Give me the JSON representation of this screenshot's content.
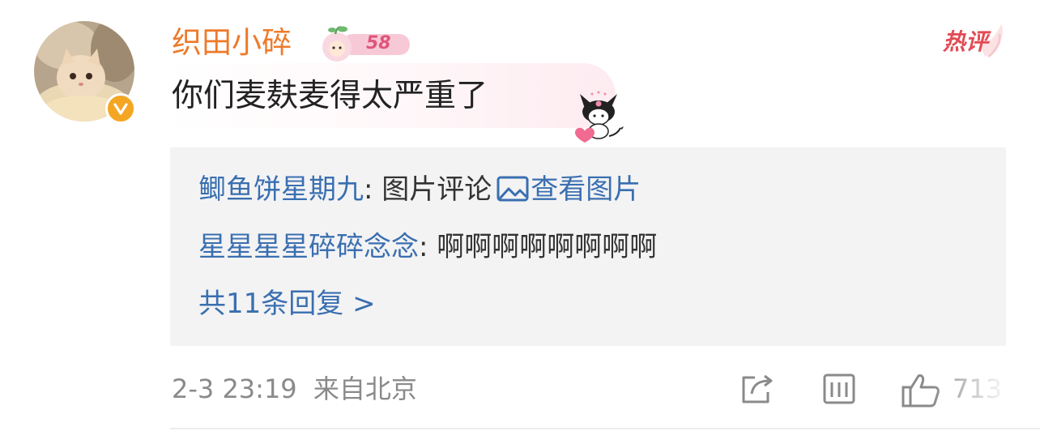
{
  "comment": {
    "username": "织田小碎",
    "level_badge": "58",
    "hot_label": "热评",
    "text": "你们麦麸麦得太严重了",
    "colors": {
      "username": "#ee7a2a",
      "link": "#3a6fb0",
      "verified": "#f4a623",
      "hot": "#e34b55"
    }
  },
  "replies": [
    {
      "user": "鲫鱼饼星期九",
      "sep": ": ",
      "text": "图片评论",
      "link_text": "查看图片"
    },
    {
      "user": "星星星星碎碎念念",
      "sep": ": ",
      "text": "啊啊啊啊啊啊啊啊"
    }
  ],
  "more_replies": "共11条回复 >",
  "meta": {
    "time": "2-3 23:19",
    "location": "来自北京"
  },
  "actions": {
    "like_count": "713"
  },
  "icons": [
    "verified-badge-icon",
    "share-icon",
    "comment-icon",
    "like-icon",
    "image-icon",
    "kuromi-sticker-icon"
  ]
}
